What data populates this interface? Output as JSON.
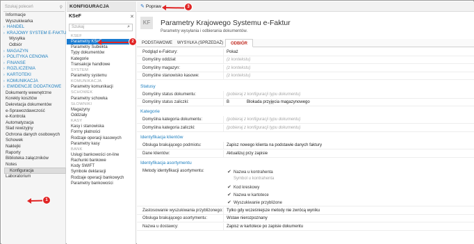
{
  "nav": {
    "search_placeholder": "Szukaj poleceń",
    "items": [
      {
        "label": "Informacje",
        "type": "l0"
      },
      {
        "label": "Wyszukiwarka",
        "type": "l0"
      },
      {
        "label": "HANDEL",
        "type": "sec"
      },
      {
        "label": "KRAJOWY SYSTEM E-FAKTUR",
        "type": "sec"
      },
      {
        "label": "Wysyłka",
        "type": "l1"
      },
      {
        "label": "Odbiór",
        "type": "l1"
      },
      {
        "label": "MAGAZYN",
        "type": "sec"
      },
      {
        "label": "POLITYKA CENOWA",
        "type": "sec"
      },
      {
        "label": "FINANSE",
        "type": "sec"
      },
      {
        "label": "ROZLICZENIA",
        "type": "sec"
      },
      {
        "label": "KARTOTEKI",
        "type": "sec"
      },
      {
        "label": "KOMUNIKACJA",
        "type": "sec"
      },
      {
        "label": "EWIDENCJE DODATKOWE",
        "type": "sec"
      },
      {
        "label": "Dokumenty wewnętrzne",
        "type": "l0"
      },
      {
        "label": "Korekty kosztów",
        "type": "l0"
      },
      {
        "label": "Dekretacja dokumentów",
        "type": "l0"
      },
      {
        "label": "e-Sprawozdawczość",
        "type": "l0"
      },
      {
        "label": "e-Kontrola",
        "type": "l0"
      },
      {
        "label": "Automatyzacja",
        "type": "l0"
      },
      {
        "label": "Ślad rewizyjny",
        "type": "l0"
      },
      {
        "label": "Ochrona danych osobowych",
        "type": "l0"
      },
      {
        "label": "Schowek",
        "type": "l0"
      },
      {
        "label": "Naklejki",
        "type": "l0"
      },
      {
        "label": "Raporty",
        "type": "l0"
      },
      {
        "label": "Biblioteka załączników",
        "type": "l0"
      },
      {
        "label": "Notes",
        "type": "l0"
      },
      {
        "label": "Konfiguracja",
        "type": "sel"
      },
      {
        "label": "Laboratorium",
        "type": "l0"
      }
    ]
  },
  "config": {
    "header": "KONFIGURACJA",
    "subheader": "KSeF",
    "search_placeholder": "Szukaj",
    "items": [
      {
        "label": "KSEF",
        "type": "g"
      },
      {
        "label": "Parametry KSeF",
        "type": "sel"
      },
      {
        "label": "Parametry Subiekta",
        "type": "i"
      },
      {
        "label": "Typy dokumentów",
        "type": "i"
      },
      {
        "label": "Kategorie",
        "type": "i"
      },
      {
        "label": "Transakcje handlowe",
        "type": "i"
      },
      {
        "label": "SYSTEM",
        "type": "g"
      },
      {
        "label": "Parametry systemu",
        "type": "i"
      },
      {
        "label": "KOMUNIKACJA",
        "type": "g"
      },
      {
        "label": "Parametry komunikacji",
        "type": "i"
      },
      {
        "label": "SCHOWEK",
        "type": "g"
      },
      {
        "label": "Parametry schowka",
        "type": "i"
      },
      {
        "label": "SŁOWNIKI",
        "type": "g"
      },
      {
        "label": "Magazyny",
        "type": "i"
      },
      {
        "label": "Oddziały",
        "type": "i"
      },
      {
        "label": "KASY",
        "type": "g"
      },
      {
        "label": "Kasy i stanowiska",
        "type": "i"
      },
      {
        "label": "Formy płatności",
        "type": "i"
      },
      {
        "label": "Rodzaje operacji kasowych",
        "type": "i"
      },
      {
        "label": "Parametry kasy",
        "type": "i"
      },
      {
        "label": "BANK",
        "type": "g"
      },
      {
        "label": "Usługi bankowości on-line",
        "type": "i"
      },
      {
        "label": "Rachunki bankowe",
        "type": "i"
      },
      {
        "label": "Kody SWIFT",
        "type": "i"
      },
      {
        "label": "Symbole deklaracji",
        "type": "i"
      },
      {
        "label": "Rodzaje operacji bankowych",
        "type": "i"
      },
      {
        "label": "Parametry bankowości",
        "type": "i"
      }
    ]
  },
  "toolbar": {
    "edit_label": "Popraw"
  },
  "page": {
    "icon_text": "KF",
    "title": "Parametry Krajowego Systemu e-Faktur",
    "subtitle": "Parametry wysyłania i odbierania dokumentów."
  },
  "tabs": [
    {
      "label": "PODSTAWOWE",
      "active": false
    },
    {
      "label": "WYSYŁKA (SPRZEDAŻ)",
      "active": false
    },
    {
      "label": "ODBIÓR",
      "active": true
    }
  ],
  "form": {
    "general": [
      {
        "label": "Podgląd e-Faktury:",
        "value": "Pokaż",
        "hint": false
      },
      {
        "label": "Domyślny oddział:",
        "value": "(z kontekstu)",
        "hint": true
      },
      {
        "label": "Domyślny magazyn:",
        "value": "(z kontekstu)",
        "hint": true
      },
      {
        "label": "Domyślne stanowisko kasowe:",
        "value": "(z kontekstu)",
        "hint": true
      }
    ],
    "statuses_title": "Statusy",
    "statuses": [
      {
        "label": "Domyślny status dokumentu:",
        "value": "(pobieraj z konfiguracji typu dokumentu)",
        "hint": true,
        "extra": ""
      },
      {
        "label": "Domyślny status zaliczki:",
        "value": "B",
        "hint": false,
        "extra": "Blokada przyjęcia magazynowego"
      }
    ],
    "categories_title": "Kategorie",
    "categories": [
      {
        "label": "Domyślna kategoria dokumentu:",
        "value": "(pobieraj z konfiguracji typu dokumentu)",
        "hint": true
      },
      {
        "label": "Domyślna kategoria zaliczki:",
        "value": "(pobieraj z konfiguracji typu dokumentu)",
        "hint": true
      }
    ],
    "clients_title": "Identyfikacja klientów",
    "clients": [
      {
        "label": "Obsługa brakującego podmiotu:",
        "value": "Zapisz nowego klienta na podstawie danych faktury",
        "hint": false
      },
      {
        "label": "Dane klientów:",
        "value": "Aktualizuj przy zapisie",
        "hint": false
      }
    ],
    "assortment_title": "Identyfikacja asortymentu",
    "methods_label": "Metody identyfikacji asortymentu:",
    "methods": [
      {
        "label": "Nazwa u kontrahenta",
        "checked": true
      },
      {
        "label": "Symbol u kontrahenta",
        "checked": false
      },
      {
        "label": "Kod kreskowy",
        "checked": true
      },
      {
        "label": "Nazwa w kartotece",
        "checked": true
      },
      {
        "label": "Wyszukiwanie przybliżone",
        "checked": true
      }
    ],
    "assortment_rows": [
      {
        "label": "Zastosowanie wyszukiwania przybliżonego:",
        "value": "Tylko gdy wcześniejsze metody nie zwrócą wyniku"
      },
      {
        "label": "Obsługa brakującego asortymentu:",
        "value": "Wstaw nierozpoznany"
      },
      {
        "label": "Nazwa u dostawcy:",
        "value": "Zapisz w kartotece po zapisie dokumentu"
      }
    ]
  },
  "annotations": {
    "badge_1": "1",
    "badge_2": "2",
    "badge_3": "3",
    "color": "#e02424"
  }
}
